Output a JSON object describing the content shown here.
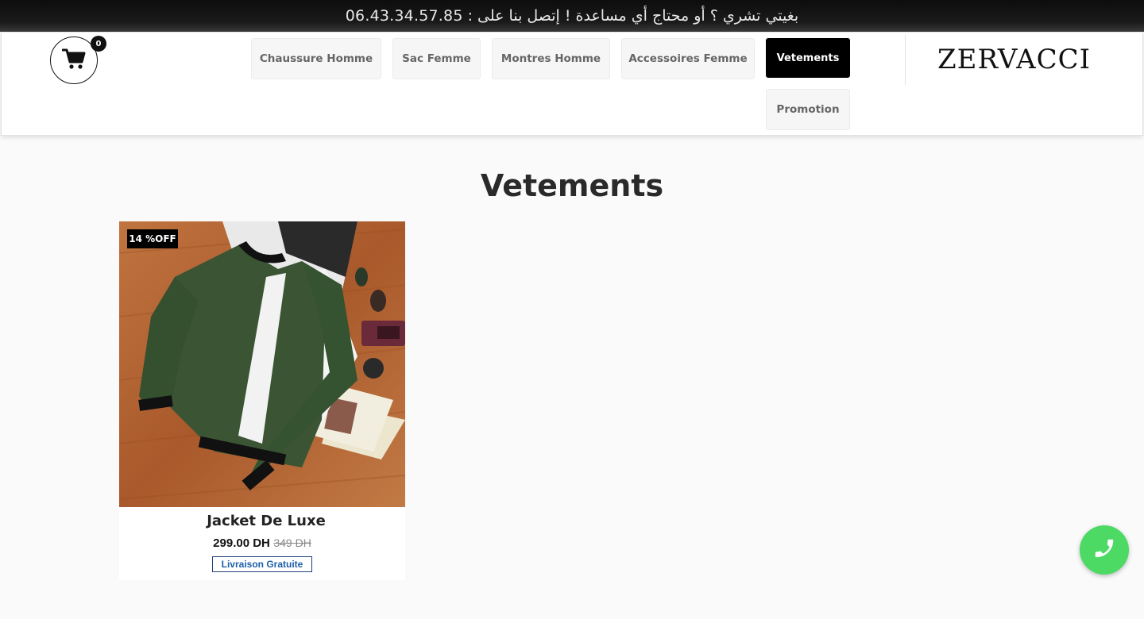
{
  "topbar": {
    "message": "بغيتي تشري ؟ أو محتاج أي مساعدة ! إتصل بنا على :",
    "phone": "06.43.34.57.85"
  },
  "header": {
    "cart_count": "0",
    "logo": "ZERVACCI",
    "nav": [
      {
        "label": "Chaussure Homme",
        "active": false
      },
      {
        "label": "Sac Femme",
        "active": false
      },
      {
        "label": "Montres Homme",
        "active": false
      },
      {
        "label": "Accessoires Femme",
        "active": false
      },
      {
        "label": "Vetements",
        "active": true
      },
      {
        "label": "Promotion",
        "active": false
      }
    ]
  },
  "main": {
    "title": "Vetements",
    "products": [
      {
        "badge": "14 %OFF",
        "name": "Jacket De Luxe",
        "price": "299.00 DH",
        "old_price": "349 DH",
        "shipping": "Livraison Gratuite"
      }
    ]
  },
  "icons": {
    "cart": "shopping-cart-icon",
    "phone": "phone-icon"
  },
  "colors": {
    "active_nav": "#000000",
    "phone_button": "#4cd964",
    "shipping_text": "#1d5fa8"
  }
}
